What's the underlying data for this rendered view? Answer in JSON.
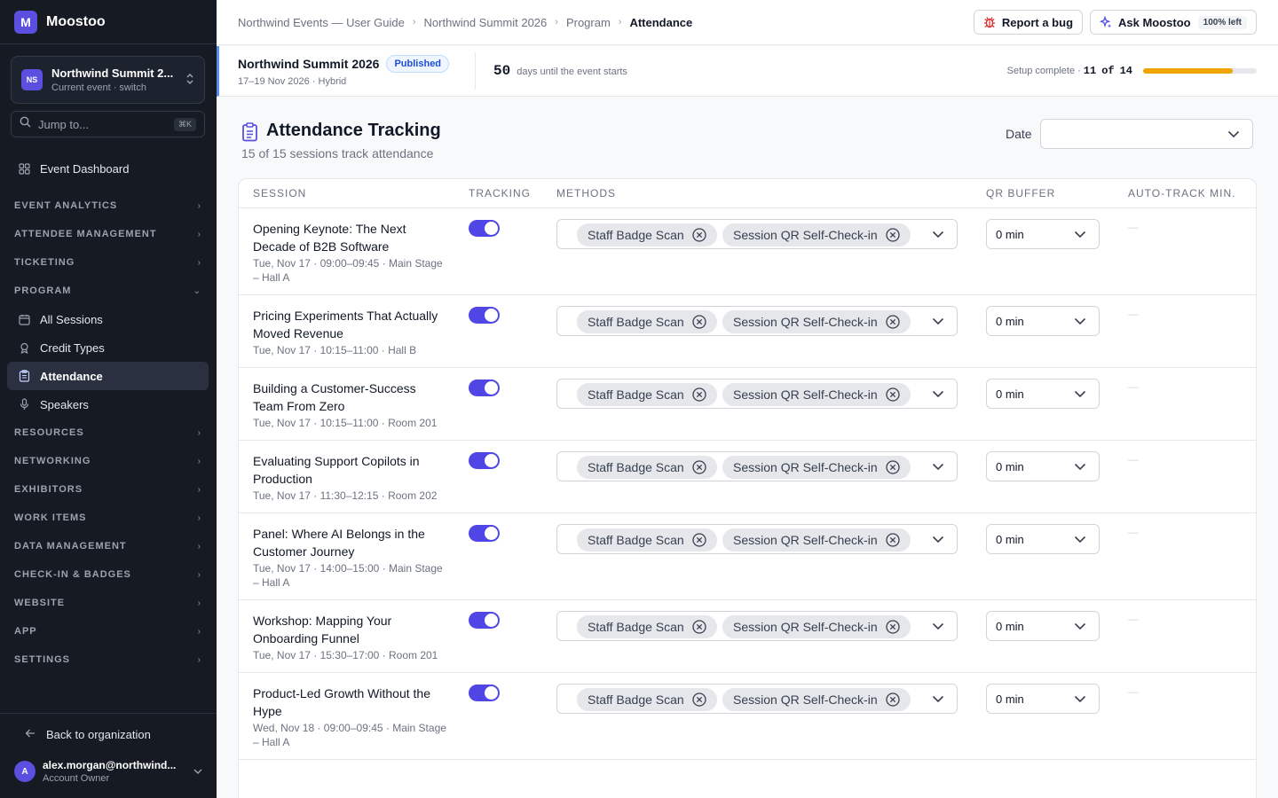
{
  "brand": {
    "logo": "M",
    "name": "Moostoo"
  },
  "sidebar": {
    "event_badge": "NS",
    "event_name": "Northwind Summit 2...",
    "event_sub": "Current event · switch",
    "jump_placeholder": "Jump to...",
    "jump_kbd": "⌘K",
    "items": {
      "dashboard": "Event Dashboard",
      "event_analytics": "EVENT ANALYTICS",
      "attendee_management": "ATTENDEE MANAGEMENT",
      "ticketing": "TICKETING",
      "program": "PROGRAM",
      "all_sessions": "All Sessions",
      "credit_types": "Credit Types",
      "attendance": "Attendance",
      "speakers": "Speakers",
      "resources": "RESOURCES",
      "networking": "NETWORKING",
      "exhibitors": "EXHIBITORS",
      "work_items": "WORK ITEMS",
      "data_management": "DATA MANAGEMENT",
      "checkin_badges": "CHECK-IN & BADGES",
      "website": "WEBSITE",
      "app": "APP",
      "settings": "SETTINGS"
    },
    "back_label": "Back to organization",
    "user_initial": "A",
    "user_email": "alex.morgan@northwind...",
    "user_role": "Account Owner"
  },
  "topbar": {
    "crumbs": [
      "Northwind Events — User Guide",
      "Northwind Summit 2026",
      "Program",
      "Attendance"
    ],
    "report_bug": "Report a bug",
    "ask": "Ask Moostoo",
    "quota": "100% left"
  },
  "event": {
    "title": "Northwind Summit 2026",
    "status": "Published",
    "dates": "17–19 Nov 2026 · Hybrid",
    "days": "50",
    "days_text": "days until the event starts",
    "setup_label": "Setup complete ·",
    "setup_done": "11",
    "setup_of": "of",
    "setup_total": "14",
    "setup_fraction": 0.786
  },
  "page": {
    "title": "Attendance Tracking",
    "subtitle": "15 of 15 sessions track attendance",
    "date_label": "Date",
    "date_value": ""
  },
  "table": {
    "headers": {
      "session": "SESSION",
      "tracking": "TRACKING",
      "methods": "METHODS",
      "qr_buffer": "QR BUFFER",
      "auto_track": "AUTO-TRACK MIN."
    },
    "rows": [
      {
        "title": "Opening Keynote: The Next Decade of B2B Software",
        "meta": "Tue, Nov 17 · 09:00–09:45 · Main Stage – Hall A",
        "tracking": true,
        "methods": [
          "Staff Badge Scan",
          "Session QR Self-Check-in"
        ],
        "qr_buffer": "0 min",
        "auto_track": "—"
      },
      {
        "title": "Pricing Experiments That Actually Moved Revenue",
        "meta": "Tue, Nov 17 · 10:15–11:00 · Hall B",
        "tracking": true,
        "methods": [
          "Staff Badge Scan",
          "Session QR Self-Check-in"
        ],
        "qr_buffer": "0 min",
        "auto_track": "—"
      },
      {
        "title": "Building a Customer-Success Team From Zero",
        "meta": "Tue, Nov 17 · 10:15–11:00 · Room 201",
        "tracking": true,
        "methods": [
          "Staff Badge Scan",
          "Session QR Self-Check-in"
        ],
        "qr_buffer": "0 min",
        "auto_track": "—"
      },
      {
        "title": "Evaluating Support Copilots in Production",
        "meta": "Tue, Nov 17 · 11:30–12:15 · Room 202",
        "tracking": true,
        "methods": [
          "Staff Badge Scan",
          "Session QR Self-Check-in"
        ],
        "qr_buffer": "0 min",
        "auto_track": "—"
      },
      {
        "title": "Panel: Where AI Belongs in the Customer Journey",
        "meta": "Tue, Nov 17 · 14:00–15:00 · Main Stage – Hall A",
        "tracking": true,
        "methods": [
          "Staff Badge Scan",
          "Session QR Self-Check-in"
        ],
        "qr_buffer": "0 min",
        "auto_track": "—"
      },
      {
        "title": "Workshop: Mapping Your Onboarding Funnel",
        "meta": "Tue, Nov 17 · 15:30–17:00 · Room 201",
        "tracking": true,
        "methods": [
          "Staff Badge Scan",
          "Session QR Self-Check-in"
        ],
        "qr_buffer": "0 min",
        "auto_track": "—"
      },
      {
        "title": "Product-Led Growth Without the Hype",
        "meta": "Wed, Nov 18 · 09:00–09:45 · Main Stage – Hall A",
        "tracking": true,
        "methods": [
          "Staff Badge Scan",
          "Session QR Self-Check-in"
        ],
        "qr_buffer": "0 min",
        "auto_track": "—"
      }
    ]
  },
  "colors": {
    "accent": "#4f46e5",
    "sidebar_bg": "#151a23",
    "progress": "#f0a500",
    "status_badge": "#1d4ed8"
  }
}
